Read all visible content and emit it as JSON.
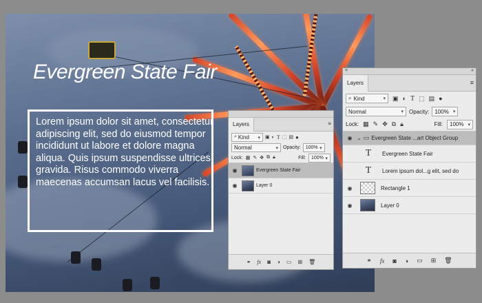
{
  "canvas": {
    "title": "Evergreen State Fair",
    "body": "Lorem ipsum dolor sit amet, consectetur adipiscing elit, sed do eiusmod tempor incididunt ut labore et dolore magna aliqua. Quis ipsum suspendisse ultrices gravida. Risus commodo viverra maecenas accumsan lacus vel facilisis."
  },
  "small_panel": {
    "tab": "Layers",
    "kind": "Kind",
    "blend": "Normal",
    "opacity_label": "Opacity:",
    "opacity": "100%",
    "lock_label": "Lock:",
    "fill_label": "Fill:",
    "fill": "100%",
    "layers": [
      {
        "name": "Evergreen State Fair",
        "thumb": "text-thumb",
        "selected": true
      },
      {
        "name": "Layer 0",
        "thumb": "photo-thumb",
        "selected": false
      }
    ]
  },
  "large_panel": {
    "tab": "Layers",
    "kind": "Kind",
    "blend": "Normal",
    "opacity_label": "Opacity:",
    "opacity": "100%",
    "lock_label": "Lock:",
    "fill_label": "Fill:",
    "fill": "100%",
    "layers": [
      {
        "name": "Evergreen State ...art Object Group",
        "type": "group",
        "selected": true
      },
      {
        "name": "Evergreen State Fair",
        "type": "text"
      },
      {
        "name": "Lorem ipsum dol...g elit, sed do",
        "type": "text"
      },
      {
        "name": "Rectangle 1",
        "type": "shape"
      },
      {
        "name": "Layer 0",
        "type": "photo"
      }
    ]
  },
  "footer_icons": [
    "link-icon",
    "fx-icon",
    "mask-icon",
    "adjustment-icon",
    "folder-icon",
    "new-layer-icon",
    "trash-icon"
  ],
  "colors": {
    "selected_row": "#bcbcbc",
    "panel_bg": "#ececec",
    "app_bg": "#8c8c8c"
  }
}
